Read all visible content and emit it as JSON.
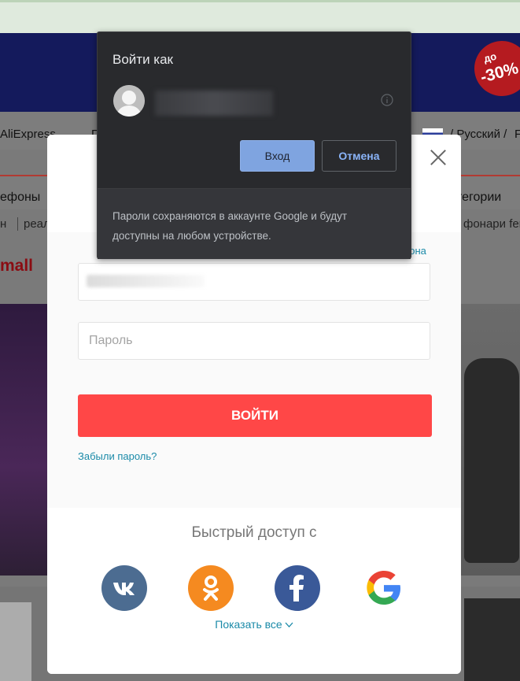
{
  "background": {
    "promo": {
      "small": "до",
      "big": "-30%"
    },
    "nav": {
      "brand": "AliExpress",
      "partial": "П",
      "language": "/ Русский /",
      "extra": "F"
    },
    "categories": {
      "left": "ефоны",
      "right": "тегории"
    },
    "subrow": {
      "left1": "н",
      "left2": "реал",
      "right": "фонари fer"
    },
    "tmall": "mall"
  },
  "login_modal": {
    "phone_link": "рона",
    "password_placeholder": "Пароль",
    "login_button": "ВОЙТИ",
    "forgot_password": "Забыли пароль?",
    "quick_access_title": "Быстрый доступ с",
    "social": [
      {
        "name": "vk",
        "icon": "vk-icon",
        "color": "#4c6c91"
      },
      {
        "name": "odnoklassniki",
        "icon": "odnoklassniki-icon",
        "color": "#f58a20"
      },
      {
        "name": "facebook",
        "icon": "facebook-icon",
        "color": "#3a5998"
      },
      {
        "name": "google",
        "icon": "google-icon",
        "color": "#4285f4"
      }
    ],
    "show_all": "Показать все"
  },
  "google_prompt": {
    "title": "Войти как",
    "login_button": "Вход",
    "cancel_button": "Отмена",
    "footer": "Пароли сохраняются в аккаунте Google и будут доступны на любом устройстве."
  }
}
